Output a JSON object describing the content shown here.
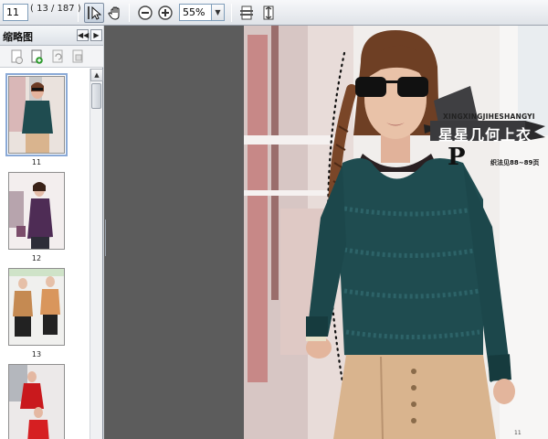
{
  "toolbar": {
    "page_value": "11",
    "page_count": "( 13 / 187 )",
    "zoom_value": "55%"
  },
  "sidebar": {
    "title": "缩略图",
    "thumbnails": [
      {
        "label": "11"
      },
      {
        "label": "12"
      },
      {
        "label": "13"
      },
      {
        "label": ""
      }
    ]
  },
  "page": {
    "header_en": "XINGXINGJIHESHANGYI",
    "header_cn": "星星几何上衣",
    "header_sub": "织法见88~89页",
    "page_number": "11"
  },
  "colors": {
    "sweater": "#1f4c50",
    "pants": "#d9b48e",
    "toolbar": "#e4e8ec",
    "doc_bg": "#5c5c5c"
  }
}
